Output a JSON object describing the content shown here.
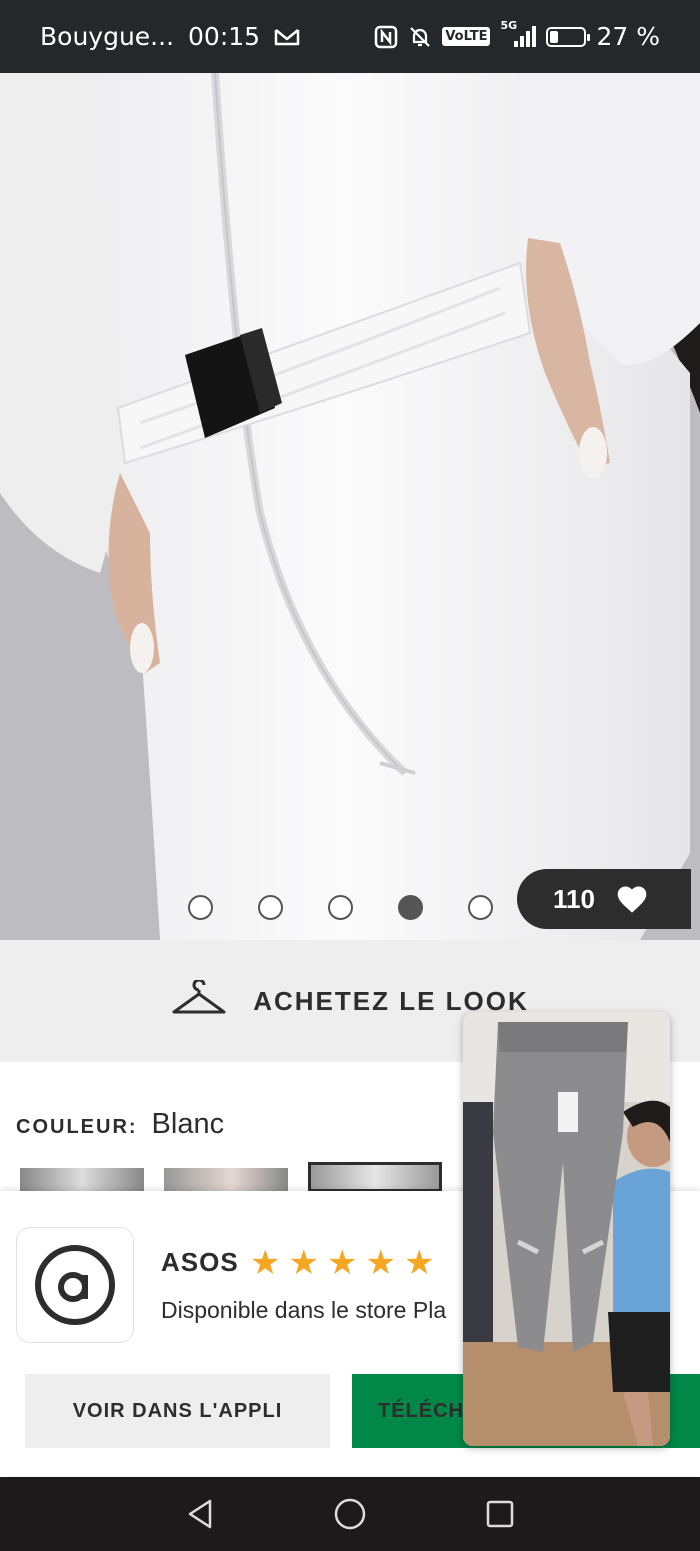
{
  "status_bar": {
    "carrier": "Bouygue...",
    "time": "00:15",
    "network": "5G",
    "volte": "VoLTE",
    "battery_text": "27 %",
    "battery_level": 0.27
  },
  "gallery": {
    "dot_count": 5,
    "active_dot": 4,
    "likes": "110"
  },
  "shop_look": {
    "label": "ACHETEZ LE LOOK"
  },
  "colour": {
    "label": "COULEUR:",
    "value": "Blanc"
  },
  "app_banner": {
    "app_name": "ASOS",
    "rating": 5,
    "subtitle": "Disponible dans le store Pla",
    "open_button": "VOIR DANS L'APPLI",
    "download_button": "TÉLÉCHA"
  },
  "icons": {
    "likes": "heart-icon",
    "shop_look": "hanger-icon",
    "app": "asos-logo-icon",
    "nav_back": "back-triangle-icon",
    "nav_home": "home-circle-icon",
    "nav_recent": "recent-square-icon"
  },
  "colors": {
    "accent_green": "#018849",
    "star": "#f5a623",
    "dark": "#2d2d2d"
  }
}
